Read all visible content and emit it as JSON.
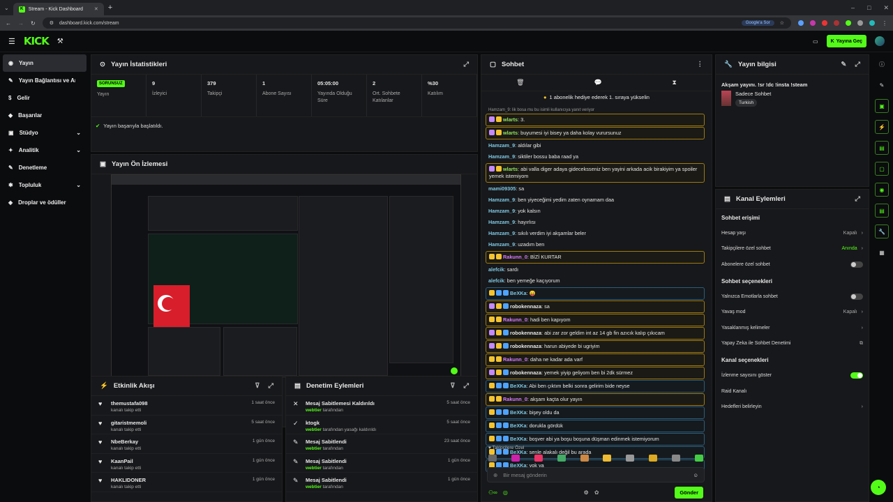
{
  "browser": {
    "tab_title": "Stream - Kick Dashboard",
    "url": "dashboard.kick.com/stream",
    "google_sor": "Google'a Sor",
    "new_tab": "+"
  },
  "top": {
    "logo": "KICK",
    "go_live": "Yayına Geç"
  },
  "sidebar": {
    "items": [
      {
        "label": "Yayın",
        "chev": "",
        "active": true,
        "icon": "◉"
      },
      {
        "label": "Yayın Bağlantısı ve Anahtarı",
        "chev": "",
        "icon": "✎"
      },
      {
        "label": "Gelir",
        "chev": "",
        "icon": "$"
      },
      {
        "label": "Başarılar",
        "chev": "",
        "icon": "◆"
      },
      {
        "label": "Stüdyo",
        "chev": "⌄",
        "icon": "▣"
      },
      {
        "label": "Analitik",
        "chev": "⌄",
        "icon": "✦"
      },
      {
        "label": "Denetleme",
        "chev": "",
        "icon": "✎"
      },
      {
        "label": "Topluluk",
        "chev": "⌄",
        "icon": "✱"
      },
      {
        "label": "Droplar ve ödüller",
        "chev": "",
        "icon": "◈"
      }
    ]
  },
  "stats": {
    "title": "Yayın İstatistikleri",
    "items": [
      {
        "value": "SORUNSUZ",
        "label": "Yayın",
        "badge": true
      },
      {
        "value": "9",
        "label": "İzleyici"
      },
      {
        "value": "379",
        "label": "Takipçi"
      },
      {
        "value": "1",
        "label": "Abone Sayısı"
      },
      {
        "value": "05:05:00",
        "label": "Yayında Olduğu Süre"
      },
      {
        "value": "2",
        "label": "Ort. Sohbete Katılanlar"
      },
      {
        "value": "%30",
        "label": "Katılım"
      }
    ],
    "success": "Yayın başarıyla başlatıldı."
  },
  "preview": {
    "title": "Yayın Ön İzlemesi"
  },
  "activity": {
    "title": "Etkinlik Akışı",
    "items": [
      {
        "name": "themustafa098",
        "sub": "kanalı takip etti",
        "time": "1 saat önce"
      },
      {
        "name": "gitaristmemoli",
        "sub": "kanalı takip etti",
        "time": "5 saat önce"
      },
      {
        "name": "NbeBerkay",
        "sub": "kanalı takip etti",
        "time": "1 gün önce"
      },
      {
        "name": "KaanPail",
        "sub": "kanalı takip etti",
        "time": "1 gün önce"
      },
      {
        "name": "HAKLIDONER",
        "sub": "kanalı takip etti",
        "time": "1 gün önce"
      }
    ]
  },
  "moderation": {
    "title": "Denetim Eylemleri",
    "items": [
      {
        "name": "Mesaj Sabitlemesi Kaldırıldı",
        "by": "webtier",
        "sub": "tarafından",
        "time": "5 saat önce",
        "icon": "✕"
      },
      {
        "name": "ktogk",
        "by": "webtier",
        "sub": "tarafından yasağı kaldırıldı",
        "time": "5 saat önce",
        "icon": "✓"
      },
      {
        "name": "Mesaj Sabitlendi",
        "by": "webtier",
        "sub": "tarafından",
        "time": "23 saat önce",
        "icon": "✎"
      },
      {
        "name": "Mesaj Sabitlendi",
        "by": "webtier",
        "sub": "tarafından",
        "time": "1 gün önce",
        "icon": "✎"
      },
      {
        "name": "Mesaj Sabitlendi",
        "by": "webtier",
        "sub": "tarafından",
        "time": "1 gün önce",
        "icon": "✎"
      }
    ]
  },
  "chat": {
    "title": "Sohbet",
    "gift": "1 abonelik hediye ederek 1. sıraya yükselin",
    "messages": [
      {
        "reply": "Hamzam_9: lik bosa mu bu isimli kullanıcıya yanıt veriyor"
      },
      {
        "user": "wlarts",
        "text": "3.",
        "color": "#8fe35a",
        "style": "hl",
        "badges": [
          "#c58af9",
          "#f4c430"
        ]
      },
      {
        "user": "wlarts",
        "text": "buyumesi iyi bisey ya daha kolay vurursunuz",
        "color": "#8fe35a",
        "style": "hl",
        "badges": [
          "#c58af9",
          "#f4c430"
        ]
      },
      {
        "user": "Hamzam_9",
        "text": "aldılar gibi",
        "color": "#7ec8e3"
      },
      {
        "user": "Hamzam_9",
        "text": "siktiler bossu baba raad ya",
        "color": "#7ec8e3"
      },
      {
        "user": "wlarts",
        "text": "abi valla diger adaya gideceksseniz ben yayini arkada acik birakiyim ya spoiler yemek istemiyom",
        "color": "#8fe35a",
        "style": "hl",
        "badges": [
          "#c58af9",
          "#f4c430"
        ]
      },
      {
        "user": "mami09305",
        "text": "sa",
        "color": "#7ec8e3"
      },
      {
        "user": "Hamzam_9",
        "text": "ben yiyeceğimi yedim zaten oynamam daa",
        "color": "#7ec8e3"
      },
      {
        "user": "Hamzam_9",
        "text": "yok kalsın",
        "color": "#7ec8e3"
      },
      {
        "user": "Hamzam_9",
        "text": "hayırlısı",
        "color": "#7ec8e3"
      },
      {
        "user": "Hamzam_9",
        "text": "sıkılı verdim iyi akşamlar beler",
        "color": "#7ec8e3"
      },
      {
        "user": "Hamzam_9",
        "text": "uzadım ben",
        "color": "#7ec8e3"
      },
      {
        "user": "Rakunn_0",
        "text": "BİZİ KURTAR",
        "color": "#d77bff",
        "style": "hl",
        "badges": [
          "#f4c430",
          "#f4c430"
        ]
      },
      {
        "user": "alefcik",
        "text": "sardı",
        "color": "#7ec8e3"
      },
      {
        "user": "alefcik",
        "text": "ben yemeğe kaçıyorum",
        "color": "#7ec8e3"
      },
      {
        "user": "BeXKa",
        "text": "😛",
        "color": "#7ec8e3",
        "style": "blue",
        "badges": [
          "#f4c430",
          "#4ea3ff",
          "#4ea3ff"
        ]
      },
      {
        "user": "robokennaza",
        "text": "sa",
        "color": "#e8e8e8",
        "style": "hl",
        "badges": [
          "#c58af9",
          "#f4c430",
          "#4ea3ff"
        ]
      },
      {
        "user": "Rakunn_0",
        "text": "hadi ben kapıyom",
        "color": "#d77bff",
        "style": "hl",
        "badges": [
          "#f4c430",
          "#f4c430"
        ]
      },
      {
        "user": "robokennaza",
        "text": "abi zar zor geldim int az 14 gb fin azıcık kalıp çıkıcam",
        "color": "#e8e8e8",
        "style": "hl",
        "badges": [
          "#c58af9",
          "#f4c430",
          "#4ea3ff"
        ]
      },
      {
        "user": "robokennaza",
        "text": "harun abiyede bi ugriyim",
        "color": "#e8e8e8",
        "style": "hl",
        "badges": [
          "#c58af9",
          "#f4c430",
          "#4ea3ff"
        ]
      },
      {
        "user": "Rakunn_0",
        "text": "daha ne kadar ada varf",
        "color": "#d77bff",
        "style": "hl",
        "badges": [
          "#f4c430",
          "#f4c430"
        ]
      },
      {
        "user": "robokennaza",
        "text": "yemek yiyip geliyom ben bi 2dk sürmez",
        "color": "#e8e8e8",
        "style": "hl",
        "badges": [
          "#c58af9",
          "#f4c430",
          "#4ea3ff"
        ]
      },
      {
        "user": "BeXKa",
        "text": "Abi ben çıktım belki sonra gelirim bide neyse",
        "color": "#7ec8e3",
        "style": "blue",
        "badges": [
          "#f4c430",
          "#4ea3ff",
          "#4ea3ff"
        ]
      },
      {
        "user": "Rakunn_0",
        "text": "akşam kaçta olur yayın",
        "color": "#d77bff",
        "style": "hl",
        "badges": [
          "#f4c430",
          "#f4c430"
        ]
      },
      {
        "user": "BeXKa",
        "text": "bişey oldu da",
        "color": "#7ec8e3",
        "style": "blue",
        "badges": [
          "#f4c430",
          "#4ea3ff",
          "#4ea3ff"
        ]
      },
      {
        "user": "BeXKa",
        "text": "dorukla gördük",
        "color": "#7ec8e3",
        "style": "blue",
        "badges": [
          "#f4c430",
          "#4ea3ff",
          "#4ea3ff"
        ]
      },
      {
        "user": "BeXKa",
        "text": "boşver abi ya boşu boşuna düşman edinmek istemiyorum",
        "color": "#7ec8e3",
        "style": "blue",
        "badges": [
          "#f4c430",
          "#4ea3ff",
          "#4ea3ff"
        ]
      },
      {
        "user": "BeXKa",
        "text": "senle alakalı değil bu arada",
        "color": "#7ec8e3",
        "style": "blue",
        "badges": [
          "#f4c430",
          "#4ea3ff",
          "#4ea3ff"
        ]
      },
      {
        "user": "BeXKa",
        "text": "yok ya",
        "color": "#7ec8e3",
        "style": "blue",
        "badges": [
          "#f4c430",
          "#4ea3ff",
          "#4ea3ff"
        ]
      }
    ],
    "followers_only": "Takipçilere Özel",
    "emote_colors": [
      "#666",
      "#c2a",
      "#e36",
      "#4a6",
      "#c84",
      "#eb3",
      "#999",
      "#da2",
      "#888",
      "#4c4"
    ],
    "input_placeholder": "Bir mesaj gönderin",
    "send": "Gönder"
  },
  "stream_info": {
    "title": "Yayın bilgisi",
    "stream_title": "Akşam yayını. !sr !dc !insta !steam",
    "category": "Sadece Sohbet",
    "tag": "Turkish"
  },
  "channel_actions": {
    "title": "Kanal Eylemleri",
    "sections": [
      {
        "title": "Sohbet erişimi",
        "options": [
          {
            "label": "Hesap yaşı",
            "value": "Kapalı",
            "kind": "chev"
          },
          {
            "label": "Takipçilere özel sohbet",
            "value": "Anında",
            "kind": "chev",
            "green": true
          },
          {
            "label": "Abonelere özel sohbet",
            "value": "",
            "kind": "toggle",
            "on": false
          }
        ]
      },
      {
        "title": "Sohbet seçenekleri",
        "options": [
          {
            "label": "Yalnızca Emotlarla sohbet",
            "value": "",
            "kind": "toggle",
            "on": false
          },
          {
            "label": "Yavaş mod",
            "value": "Kapalı",
            "kind": "chev"
          },
          {
            "label": "Yasaklanmış kelimeler",
            "value": "",
            "kind": "chev"
          },
          {
            "label": "Yapay Zeka ile Sohbet Denetimi",
            "value": "",
            "kind": "ext"
          }
        ]
      },
      {
        "title": "Kanal seçenekleri",
        "options": [
          {
            "label": "İzlenme sayısını göster",
            "value": "",
            "kind": "toggle",
            "on": true
          },
          {
            "label": "Raid Kanalı",
            "value": "",
            "kind": "none"
          },
          {
            "label": "Hedefleri belirleyin",
            "value": "",
            "kind": "chev"
          }
        ]
      }
    ]
  }
}
